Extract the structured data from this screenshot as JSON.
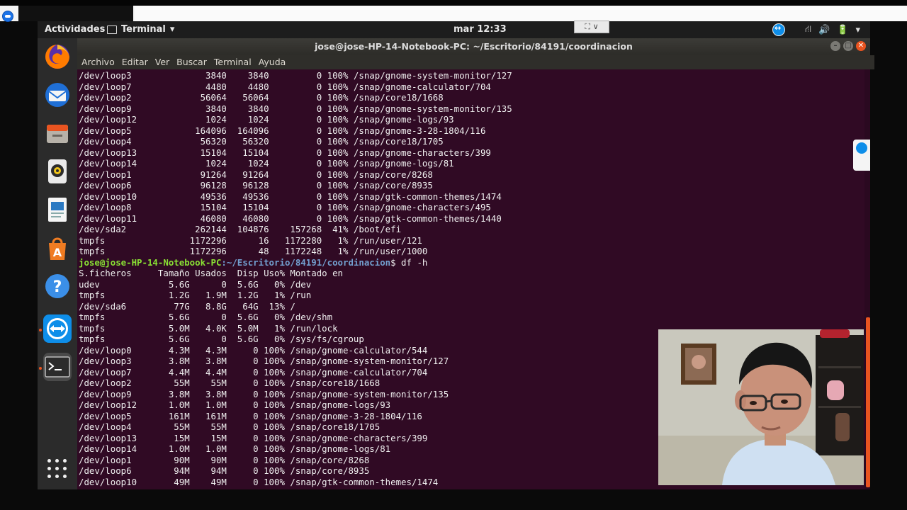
{
  "top_panel": {
    "activities": "Actividades",
    "app_menu": "Terminal",
    "app_menu_arrow": "▾",
    "clock": "mar 12:33",
    "indicator_box": "⛶ ∨",
    "tray_network": "⛙",
    "tray_volume": "🔊",
    "tray_power": "🔋",
    "tray_arrow": "▾"
  },
  "dock": {
    "items": [
      {
        "name": "firefox-icon",
        "color": "#e66000"
      },
      {
        "name": "thunderbird-icon",
        "color": "#0a84ff"
      },
      {
        "name": "files-icon",
        "color": "#9a9a9a"
      },
      {
        "name": "rhythmbox-icon",
        "color": "#f0c419"
      },
      {
        "name": "writer-icon",
        "color": "#2b79c2"
      },
      {
        "name": "software-center-icon",
        "color": "#e95420"
      },
      {
        "name": "help-icon",
        "color": "#3689e6"
      },
      {
        "name": "teamviewer-icon",
        "color": "#0e8ee9"
      },
      {
        "name": "terminal-icon",
        "color": "#300a24"
      }
    ]
  },
  "window": {
    "title": "jose@jose-HP-14-Notebook-PC: ~/Escritorio/84191/coordinacion",
    "menu": [
      "Archivo",
      "Editar",
      "Ver",
      "Buscar",
      "Terminal",
      "Ayuda"
    ]
  },
  "terminal": {
    "lines_before": [
      "/dev/loop3              3840    3840         0 100% /snap/gnome-system-monitor/127",
      "/dev/loop7              4480    4480         0 100% /snap/gnome-calculator/704",
      "/dev/loop2             56064   56064         0 100% /snap/core18/1668",
      "/dev/loop9              3840    3840         0 100% /snap/gnome-system-monitor/135",
      "/dev/loop12             1024    1024         0 100% /snap/gnome-logs/93",
      "/dev/loop5            164096  164096         0 100% /snap/gnome-3-28-1804/116",
      "/dev/loop4             56320   56320         0 100% /snap/core18/1705",
      "/dev/loop13            15104   15104         0 100% /snap/gnome-characters/399",
      "/dev/loop14             1024    1024         0 100% /snap/gnome-logs/81",
      "/dev/loop1             91264   91264         0 100% /snap/core/8268",
      "/dev/loop6             96128   96128         0 100% /snap/core/8935",
      "/dev/loop10            49536   49536         0 100% /snap/gtk-common-themes/1474",
      "/dev/loop8             15104   15104         0 100% /snap/gnome-characters/495",
      "/dev/loop11            46080   46080         0 100% /snap/gtk-common-themes/1440",
      "/dev/sda2             262144  104876    157268  41% /boot/efi",
      "tmpfs                1172296      16   1172280   1% /run/user/121",
      "tmpfs                1172296      48   1172248   1% /run/user/1000"
    ],
    "prompt_user": "jose@jose-HP-14-Notebook-PC",
    "prompt_path": ":~/Escritorio/84191/coordinacion",
    "prompt_cmd": "$ df -h",
    "lines_after": [
      "S.ficheros     Tamaño Usados  Disp Uso% Montado en",
      "udev             5.6G      0  5.6G   0% /dev",
      "tmpfs            1.2G   1.9M  1.2G   1% /run",
      "/dev/sda6         77G   8.8G   64G  13% /",
      "tmpfs            5.6G      0  5.6G   0% /dev/shm",
      "tmpfs            5.0M   4.0K  5.0M   1% /run/lock",
      "tmpfs            5.6G      0  5.6G   0% /sys/fs/cgroup",
      "/dev/loop0       4.3M   4.3M     0 100% /snap/gnome-calculator/544",
      "/dev/loop3       3.8M   3.8M     0 100% /snap/gnome-system-monitor/127",
      "/dev/loop7       4.4M   4.4M     0 100% /snap/gnome-calculator/704",
      "/dev/loop2        55M    55M     0 100% /snap/core18/1668",
      "/dev/loop9       3.8M   3.8M     0 100% /snap/gnome-system-monitor/135",
      "/dev/loop12      1.0M   1.0M     0 100% /snap/gnome-logs/93",
      "/dev/loop5       161M   161M     0 100% /snap/gnome-3-28-1804/116",
      "/dev/loop4        55M    55M     0 100% /snap/core18/1705",
      "/dev/loop13       15M    15M     0 100% /snap/gnome-characters/399",
      "/dev/loop14      1.0M   1.0M     0 100% /snap/gnome-logs/81",
      "/dev/loop1        90M    90M     0 100% /snap/core/8268",
      "/dev/loop6        94M    94M     0 100% /snap/core/8935",
      "/dev/loop10       49M    49M     0 100% /snap/gtk-common-themes/1474"
    ]
  },
  "colors": {
    "terminal_bg": "#300a24",
    "prompt_user": "#8ae234",
    "prompt_path": "#729fcf",
    "accent": "#e95420"
  }
}
